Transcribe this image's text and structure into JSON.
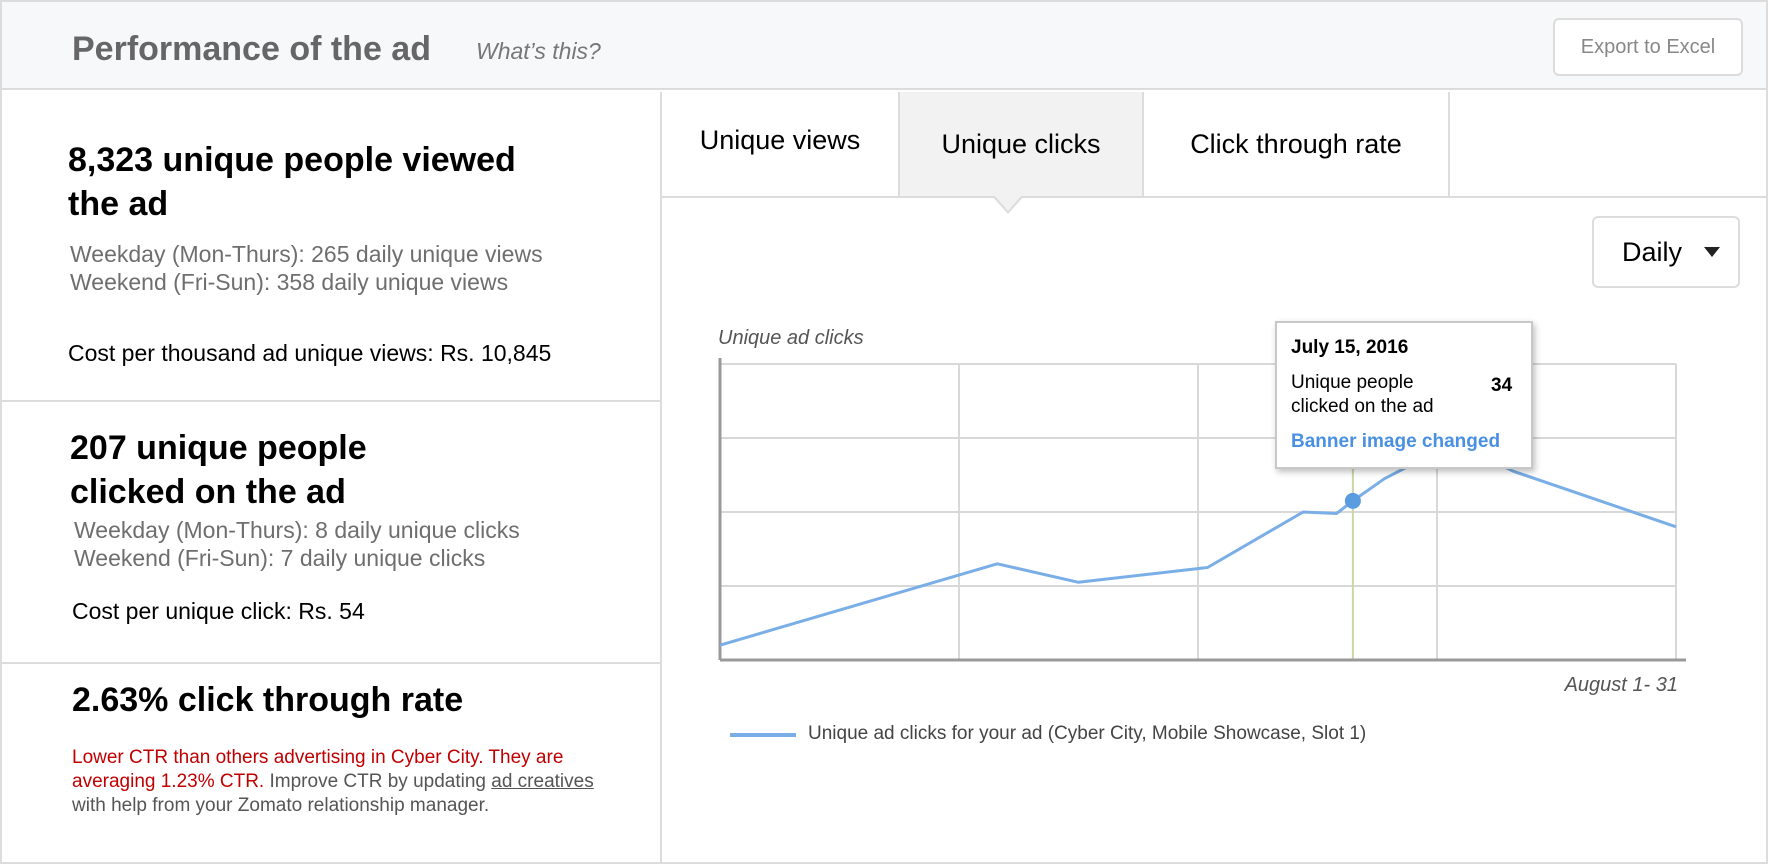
{
  "header": {
    "title": "Performance of the ad",
    "help_link": "What’s this?",
    "export_label": "Export to Excel"
  },
  "summary": {
    "views": {
      "heading_line1": "8,323 unique people viewed",
      "heading_line2": "the ad",
      "weekday": "Weekday (Mon-Thurs): 265 daily unique views",
      "weekend": "Weekend (Fri-Sun): 358 daily unique views",
      "cost": "Cost per thousand ad unique views: Rs. 10,845"
    },
    "clicks": {
      "heading_line1": "207 unique people",
      "heading_line2": "clicked on the ad",
      "weekday": "Weekday (Mon-Thurs): 8 daily unique clicks",
      "weekend": "Weekend (Fri-Sun): 7 daily unique clicks",
      "cost": "Cost per unique click: Rs. 54"
    },
    "ctr": {
      "heading": "2.63% click through rate",
      "warning": "Lower CTR than others advertising in Cyber City.  They are averaging 1.23% CTR.",
      "advice_prefix": "  Improve CTR by updating ",
      "advice_link": "ad creatives",
      "advice_suffix": " with help from your Zomato relationship manager."
    }
  },
  "tabs": [
    {
      "label": "Unique views",
      "active": false
    },
    {
      "label": "Unique clicks",
      "active": true
    },
    {
      "label": "Click through rate",
      "active": false
    }
  ],
  "period_select": {
    "value": "Daily"
  },
  "colors": {
    "series": "#7aaee6",
    "marker": "#5b9be0",
    "grid": "#d8d8d8",
    "axis": "#9a9a9a",
    "event_line": "#c8d6a8",
    "warning": "#c00000",
    "link_blue": "#4a90e2"
  },
  "chart_data": {
    "type": "line",
    "ylabel": "Unique ad clicks",
    "xlabel": "August 1- 31",
    "x": [
      0,
      0.29,
      0.375,
      0.51,
      0.61,
      0.645,
      0.662,
      0.695,
      0.725,
      0.79,
      0.83,
      1.0
    ],
    "series": [
      {
        "name": "Unique ad clicks for your ad (Cyber City, Mobile Showcase, Slot 1)",
        "values": [
          0.2,
          1.3,
          1.05,
          1.25,
          2.0,
          1.98,
          2.15,
          2.45,
          2.65,
          2.8,
          2.55,
          1.8
        ]
      }
    ],
    "ylim": [
      0,
      4
    ],
    "grid": true,
    "legend": "bottom",
    "highlight": {
      "index": 6,
      "event_x": 0.662
    },
    "tooltip": {
      "date": "July 15, 2016",
      "label": "Unique people clicked on the ad",
      "value": "34",
      "event": "Banner image changed"
    }
  }
}
